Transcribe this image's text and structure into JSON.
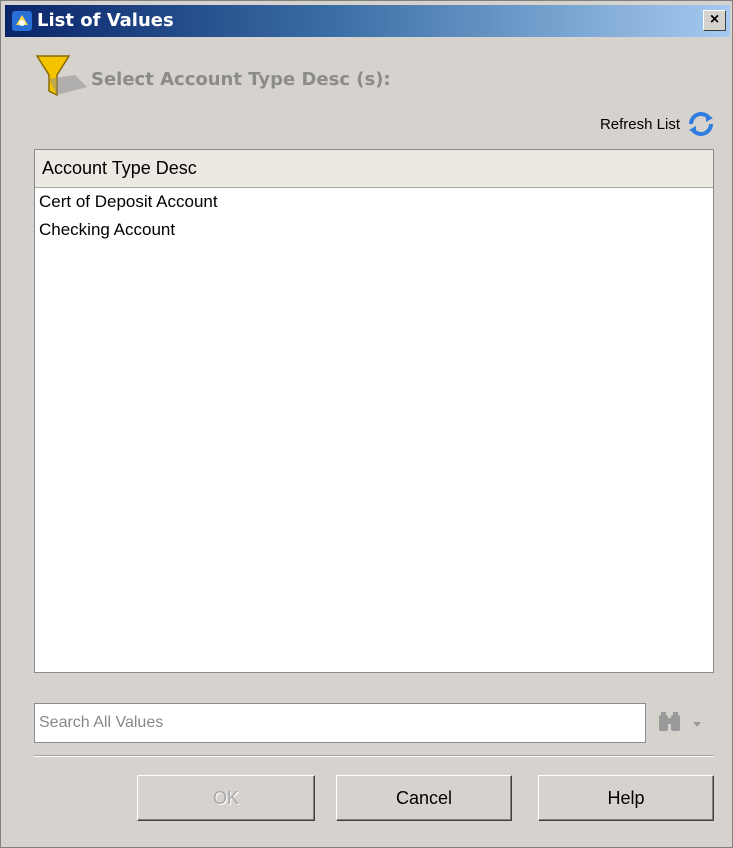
{
  "window": {
    "title": "List of Values",
    "close_label": "×"
  },
  "prompt": "Select Account Type Desc (s):",
  "refresh_label": "Refresh List",
  "list": {
    "header": "Account Type Desc",
    "items": [
      "Cert of Deposit Account",
      "Checking Account"
    ]
  },
  "search": {
    "placeholder": "Search All Values",
    "value": ""
  },
  "buttons": {
    "ok": "OK",
    "cancel": "Cancel",
    "help": "Help"
  },
  "colors": {
    "titlebar_start": "#0a246a",
    "titlebar_end": "#a6caf0",
    "filter_icon": "#f4c400",
    "refresh_icon": "#2f7de0"
  }
}
